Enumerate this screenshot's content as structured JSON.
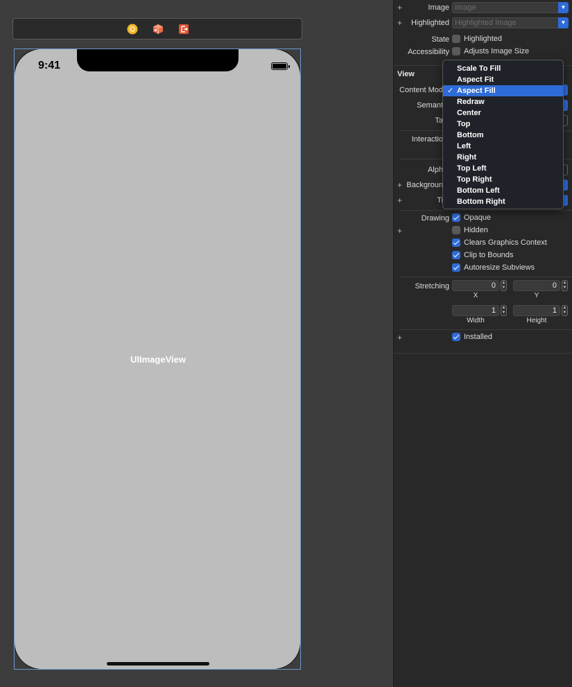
{
  "device": {
    "status_time": "9:41",
    "view_label": "UIImageView"
  },
  "inspector": {
    "image": {
      "label": "Image",
      "placeholder": "Image"
    },
    "highlighted": {
      "label": "Highlighted",
      "placeholder": "Highlighted Image"
    },
    "state": {
      "label": "State",
      "option": "Highlighted",
      "checked": false
    },
    "accessibility": {
      "label": "Accessibility",
      "option": "Adjusts Image Size",
      "checked": false
    },
    "view_section": "View",
    "partial_labels": {
      "content_mode": "Content Mod",
      "semantic": "Semant",
      "tag": "Ta",
      "interaction": "Interactio",
      "alpha": "Alph",
      "background": "Backgroun",
      "tint": "Ti"
    },
    "drawing": {
      "label": "Drawing",
      "options": [
        {
          "label": "Opaque",
          "checked": true
        },
        {
          "label": "Hidden",
          "checked": false
        },
        {
          "label": "Clears Graphics Context",
          "checked": true
        },
        {
          "label": "Clip to Bounds",
          "checked": true
        },
        {
          "label": "Autoresize Subviews",
          "checked": true
        }
      ]
    },
    "stretching": {
      "label": "Stretching",
      "x": "0",
      "y": "0",
      "width": "1",
      "height": "1",
      "x_label": "X",
      "y_label": "Y",
      "width_label": "Width",
      "height_label": "Height"
    },
    "installed": {
      "label": "Installed",
      "checked": true
    }
  },
  "content_mode_menu": {
    "selected": "Aspect Fill",
    "items": [
      "Scale To Fill",
      "Aspect Fit",
      "Aspect Fill",
      "Redraw",
      "Center",
      "Top",
      "Bottom",
      "Left",
      "Right",
      "Top Left",
      "Top Right",
      "Bottom Left",
      "Bottom Right"
    ]
  },
  "colors": {
    "accent": "#2f6bd6",
    "device_background": "#bdbdbd",
    "inspector_background": "#282828"
  }
}
